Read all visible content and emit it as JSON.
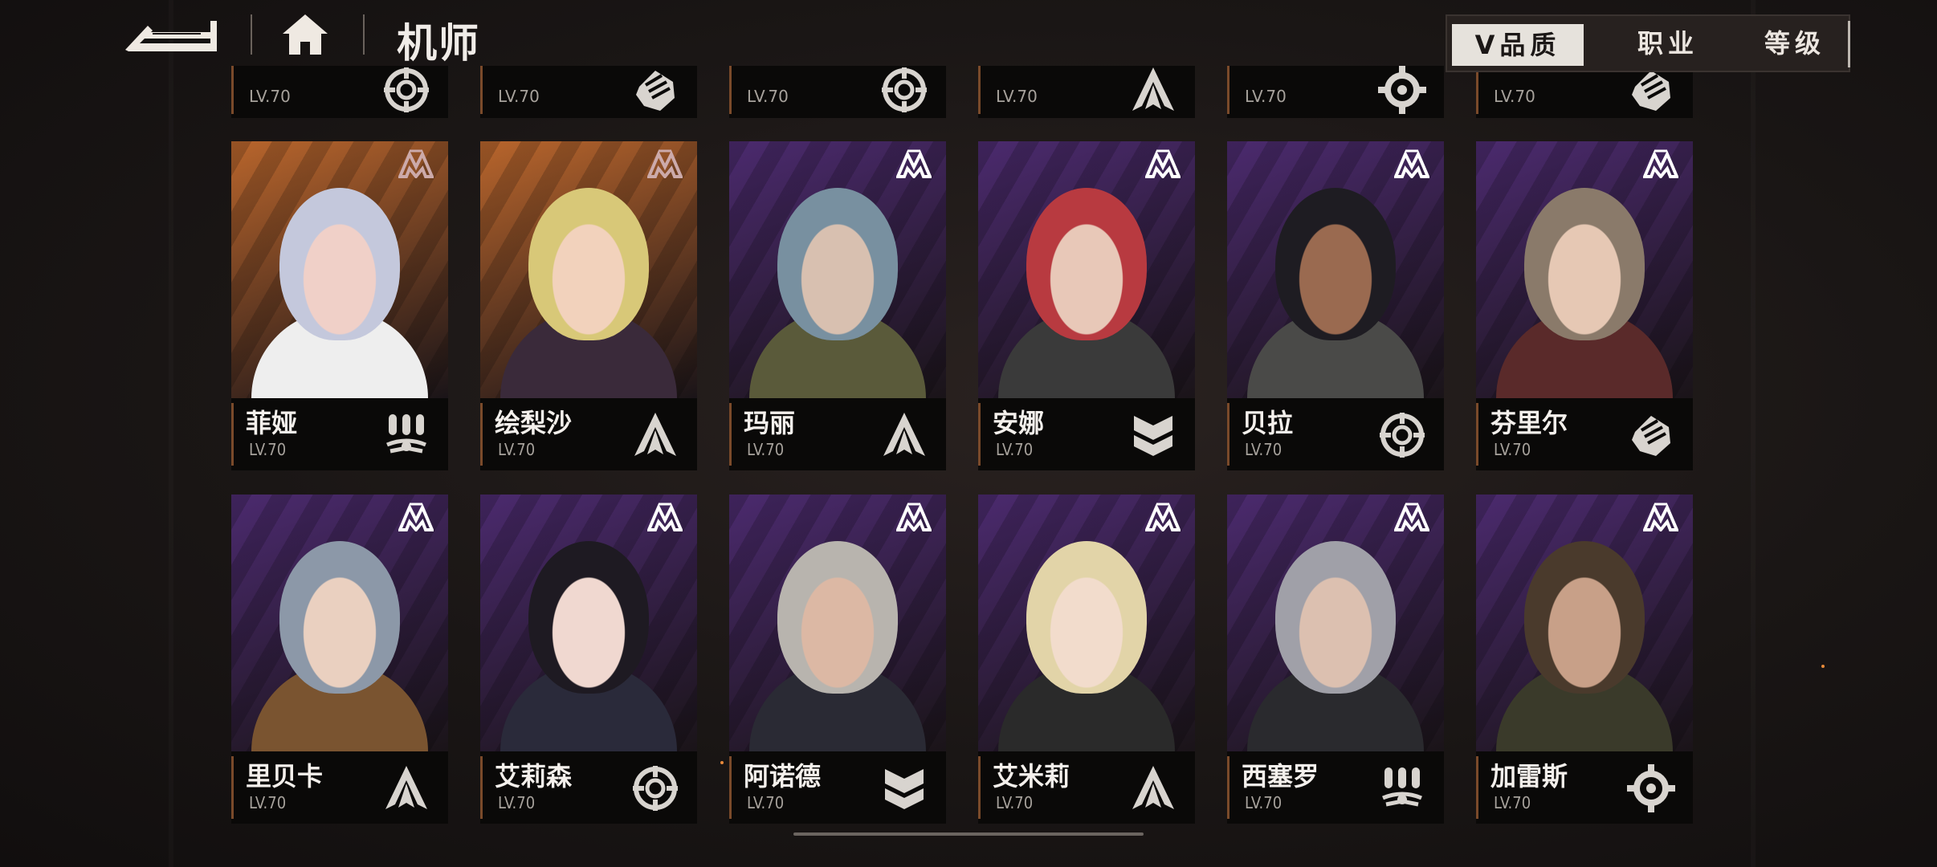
{
  "header": {
    "title": "机师",
    "back_icon": "back-arrow-icon",
    "home_icon": "home-icon"
  },
  "sort": {
    "active_label": "品质",
    "options": [
      "职业",
      "等级"
    ],
    "arrow": "V"
  },
  "top_row": [
    {
      "name": "",
      "level": "LV.70",
      "class_icon": "target"
    },
    {
      "name": "",
      "level": "LV.70",
      "class_icon": "fist"
    },
    {
      "name": "",
      "level": "LV.70",
      "class_icon": "target"
    },
    {
      "name": "",
      "level": "LV.70",
      "class_icon": "arrow"
    },
    {
      "name": "",
      "level": "LV.70",
      "class_icon": "wrench"
    },
    {
      "name": "",
      "level": "LV.70",
      "class_icon": "fist"
    }
  ],
  "pilots": [
    {
      "name": "菲娅",
      "level": "LV.70",
      "class_icon": "missiles",
      "bg": "#b8652c",
      "hair": "#c4c8dc",
      "skin": "#f0d0c8",
      "outfit": "#eeeeee",
      "rank_color": "#caa"
    },
    {
      "name": "绘梨沙",
      "level": "LV.70",
      "class_icon": "arrow",
      "bg": "#b8652c",
      "hair": "#d8c878",
      "skin": "#f2d2bc",
      "outfit": "#3a2a3a",
      "rank_color": "#caa"
    },
    {
      "name": "玛丽",
      "level": "LV.70",
      "class_icon": "arrow",
      "bg": "#4b2a6e",
      "hair": "#7890a0",
      "skin": "#d8c0b0",
      "outfit": "#5a5a3a",
      "rank_color": "#fff"
    },
    {
      "name": "安娜",
      "level": "LV.70",
      "class_icon": "shield",
      "bg": "#4b2a6e",
      "hair": "#b83a40",
      "skin": "#e8c8b8",
      "outfit": "#3a3a3a",
      "rank_color": "#fff"
    },
    {
      "name": "贝拉",
      "level": "LV.70",
      "class_icon": "target",
      "bg": "#4b2a6e",
      "hair": "#1e1c22",
      "skin": "#9a6a50",
      "outfit": "#4a4a48",
      "rank_color": "#fff"
    },
    {
      "name": "芬里尔",
      "level": "LV.70",
      "class_icon": "fist",
      "bg": "#4b2a6e",
      "hair": "#8a7a6a",
      "skin": "#e6c8b4",
      "outfit": "#5a2a2a",
      "rank_color": "#fff"
    },
    {
      "name": "里贝卡",
      "level": "LV.70",
      "class_icon": "arrow",
      "bg": "#4b2a6e",
      "hair": "#8c98a8",
      "skin": "#ead0c0",
      "outfit": "#7a5430",
      "rank_color": "#fff"
    },
    {
      "name": "艾莉森",
      "level": "LV.70",
      "class_icon": "target",
      "bg": "#4b2a6e",
      "hair": "#1e1a22",
      "skin": "#f0d8d0",
      "outfit": "#2a2a3a",
      "rank_color": "#fff"
    },
    {
      "name": "阿诺德",
      "level": "LV.70",
      "class_icon": "shield",
      "bg": "#4b2a6e",
      "hair": "#b8b4ae",
      "skin": "#dcb8a4",
      "outfit": "#2a2a34",
      "rank_color": "#fff"
    },
    {
      "name": "艾米莉",
      "level": "LV.70",
      "class_icon": "arrow",
      "bg": "#4b2a6e",
      "hair": "#e2d4a8",
      "skin": "#f2dccc",
      "outfit": "#2a2a2a",
      "rank_color": "#fff"
    },
    {
      "name": "西塞罗",
      "level": "LV.70",
      "class_icon": "missiles",
      "bg": "#4b2a6e",
      "hair": "#a0a0a8",
      "skin": "#dcc0b0",
      "outfit": "#2a2a2e",
      "rank_color": "#fff"
    },
    {
      "name": "加雷斯",
      "level": "LV.70",
      "class_icon": "wrench",
      "bg": "#4b2a6e",
      "hair": "#4a3a2c",
      "skin": "#c8a088",
      "outfit": "#3a3a2a",
      "rank_color": "#fff"
    }
  ]
}
